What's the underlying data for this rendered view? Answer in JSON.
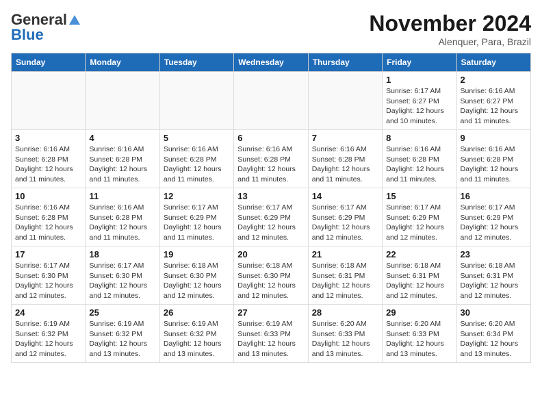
{
  "logo": {
    "general": "General",
    "blue": "Blue"
  },
  "title": "November 2024",
  "subtitle": "Alenquer, Para, Brazil",
  "days_header": [
    "Sunday",
    "Monday",
    "Tuesday",
    "Wednesday",
    "Thursday",
    "Friday",
    "Saturday"
  ],
  "weeks": [
    [
      {
        "day": "",
        "info": ""
      },
      {
        "day": "",
        "info": ""
      },
      {
        "day": "",
        "info": ""
      },
      {
        "day": "",
        "info": ""
      },
      {
        "day": "",
        "info": ""
      },
      {
        "day": "1",
        "info": "Sunrise: 6:17 AM\nSunset: 6:27 PM\nDaylight: 12 hours and 10 minutes."
      },
      {
        "day": "2",
        "info": "Sunrise: 6:16 AM\nSunset: 6:27 PM\nDaylight: 12 hours and 11 minutes."
      }
    ],
    [
      {
        "day": "3",
        "info": "Sunrise: 6:16 AM\nSunset: 6:28 PM\nDaylight: 12 hours and 11 minutes."
      },
      {
        "day": "4",
        "info": "Sunrise: 6:16 AM\nSunset: 6:28 PM\nDaylight: 12 hours and 11 minutes."
      },
      {
        "day": "5",
        "info": "Sunrise: 6:16 AM\nSunset: 6:28 PM\nDaylight: 12 hours and 11 minutes."
      },
      {
        "day": "6",
        "info": "Sunrise: 6:16 AM\nSunset: 6:28 PM\nDaylight: 12 hours and 11 minutes."
      },
      {
        "day": "7",
        "info": "Sunrise: 6:16 AM\nSunset: 6:28 PM\nDaylight: 12 hours and 11 minutes."
      },
      {
        "day": "8",
        "info": "Sunrise: 6:16 AM\nSunset: 6:28 PM\nDaylight: 12 hours and 11 minutes."
      },
      {
        "day": "9",
        "info": "Sunrise: 6:16 AM\nSunset: 6:28 PM\nDaylight: 12 hours and 11 minutes."
      }
    ],
    [
      {
        "day": "10",
        "info": "Sunrise: 6:16 AM\nSunset: 6:28 PM\nDaylight: 12 hours and 11 minutes."
      },
      {
        "day": "11",
        "info": "Sunrise: 6:16 AM\nSunset: 6:28 PM\nDaylight: 12 hours and 11 minutes."
      },
      {
        "day": "12",
        "info": "Sunrise: 6:17 AM\nSunset: 6:29 PM\nDaylight: 12 hours and 11 minutes."
      },
      {
        "day": "13",
        "info": "Sunrise: 6:17 AM\nSunset: 6:29 PM\nDaylight: 12 hours and 12 minutes."
      },
      {
        "day": "14",
        "info": "Sunrise: 6:17 AM\nSunset: 6:29 PM\nDaylight: 12 hours and 12 minutes."
      },
      {
        "day": "15",
        "info": "Sunrise: 6:17 AM\nSunset: 6:29 PM\nDaylight: 12 hours and 12 minutes."
      },
      {
        "day": "16",
        "info": "Sunrise: 6:17 AM\nSunset: 6:29 PM\nDaylight: 12 hours and 12 minutes."
      }
    ],
    [
      {
        "day": "17",
        "info": "Sunrise: 6:17 AM\nSunset: 6:30 PM\nDaylight: 12 hours and 12 minutes."
      },
      {
        "day": "18",
        "info": "Sunrise: 6:17 AM\nSunset: 6:30 PM\nDaylight: 12 hours and 12 minutes."
      },
      {
        "day": "19",
        "info": "Sunrise: 6:18 AM\nSunset: 6:30 PM\nDaylight: 12 hours and 12 minutes."
      },
      {
        "day": "20",
        "info": "Sunrise: 6:18 AM\nSunset: 6:30 PM\nDaylight: 12 hours and 12 minutes."
      },
      {
        "day": "21",
        "info": "Sunrise: 6:18 AM\nSunset: 6:31 PM\nDaylight: 12 hours and 12 minutes."
      },
      {
        "day": "22",
        "info": "Sunrise: 6:18 AM\nSunset: 6:31 PM\nDaylight: 12 hours and 12 minutes."
      },
      {
        "day": "23",
        "info": "Sunrise: 6:18 AM\nSunset: 6:31 PM\nDaylight: 12 hours and 12 minutes."
      }
    ],
    [
      {
        "day": "24",
        "info": "Sunrise: 6:19 AM\nSunset: 6:32 PM\nDaylight: 12 hours and 12 minutes."
      },
      {
        "day": "25",
        "info": "Sunrise: 6:19 AM\nSunset: 6:32 PM\nDaylight: 12 hours and 13 minutes."
      },
      {
        "day": "26",
        "info": "Sunrise: 6:19 AM\nSunset: 6:32 PM\nDaylight: 12 hours and 13 minutes."
      },
      {
        "day": "27",
        "info": "Sunrise: 6:19 AM\nSunset: 6:33 PM\nDaylight: 12 hours and 13 minutes."
      },
      {
        "day": "28",
        "info": "Sunrise: 6:20 AM\nSunset: 6:33 PM\nDaylight: 12 hours and 13 minutes."
      },
      {
        "day": "29",
        "info": "Sunrise: 6:20 AM\nSunset: 6:33 PM\nDaylight: 12 hours and 13 minutes."
      },
      {
        "day": "30",
        "info": "Sunrise: 6:20 AM\nSunset: 6:34 PM\nDaylight: 12 hours and 13 minutes."
      }
    ]
  ]
}
